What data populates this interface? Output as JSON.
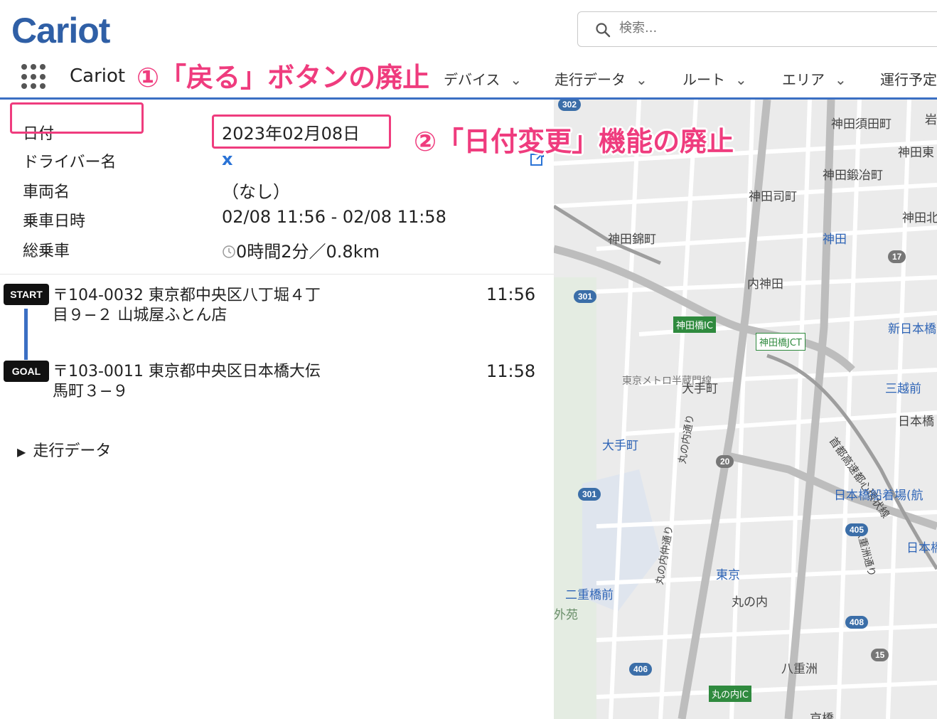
{
  "header": {
    "logo": "Cariot",
    "search_placeholder": "検索...",
    "app_name": "Cariot",
    "nav": [
      {
        "label": "デバイス"
      },
      {
        "label": "走行データ"
      },
      {
        "label": "ルート"
      },
      {
        "label": "エリア"
      },
      {
        "label": "運行予定"
      }
    ]
  },
  "annotations": {
    "one": "①「戻る」ボタンの廃止",
    "two": "②「日付変更」機能の廃止"
  },
  "detail": {
    "date_label": "日付",
    "date_value": "2023年02月08日",
    "driver_label": "ドライバー名",
    "driver_value": "x",
    "vehicle_label": "車両名",
    "vehicle_value": "（なし）",
    "ride_time_label": "乗車日時",
    "ride_time_value": "02/08 11:56 - 02/08 11:58",
    "total_label": "総乗車",
    "total_value": "0時間2分／0.8km"
  },
  "route": {
    "start": {
      "badge": "START",
      "address_line1": "〒104-0032 東京都中央区八丁堀４丁",
      "address_line2": "目９−２ 山城屋ふとん店",
      "time": "11:56"
    },
    "goal": {
      "badge": "GOAL",
      "address_line1": "〒103-0011 東京都中央区日本橋大伝",
      "address_line2": "馬町３−９",
      "time": "11:58"
    },
    "toggle_label": "走行データ"
  },
  "map": {
    "labels": {
      "kanda_sudacho": "神田須田町",
      "kanda_higashi": "神田東",
      "kanda_kajicho": "神田鍛冶町",
      "kanda_tsukasamachi": "神田司町",
      "kanda_nishikicho": "神田錦町",
      "kanda_station": "神田",
      "uchikanda": "内神田",
      "kanda_north": "神田北",
      "kandabashi_ic": "神田橋IC",
      "kandabashi_jct": "神田橋JCT",
      "shin_nihombashi": "新日本橋",
      "hanzomon_line": "東京メトロ半蔵門線",
      "otemachi_area": "大手町",
      "otemachi_station": "大手町",
      "mitsukoshimae": "三越前",
      "nihombashi_1": "日本橋",
      "shuto_loop": "首都高速都心環状線",
      "nihombashi_pier": "日本橋船着場(航",
      "marunouchi_st": "丸の内通り",
      "marunouchi_naka": "丸の内仲通り",
      "nijubashimae": "二重橋前",
      "gaien": "外苑",
      "tokyo_station": "東京",
      "marunouchi": "丸の内",
      "yaesu_street": "八重洲通り",
      "nihombashi_2": "日本橋",
      "yaesu": "八重洲",
      "marunouchi_ic": "丸の内IC",
      "kyobashi": "京橋",
      "iwamoto": "岩"
    },
    "shields": [
      "302",
      "301",
      "301",
      "405",
      "408",
      "406",
      "17",
      "20",
      "15"
    ]
  },
  "colors": {
    "brand": "#2f5fa6",
    "annotation": "#ef3c7e",
    "link": "#2a73d6",
    "nav_border": "#3b6fc3"
  }
}
